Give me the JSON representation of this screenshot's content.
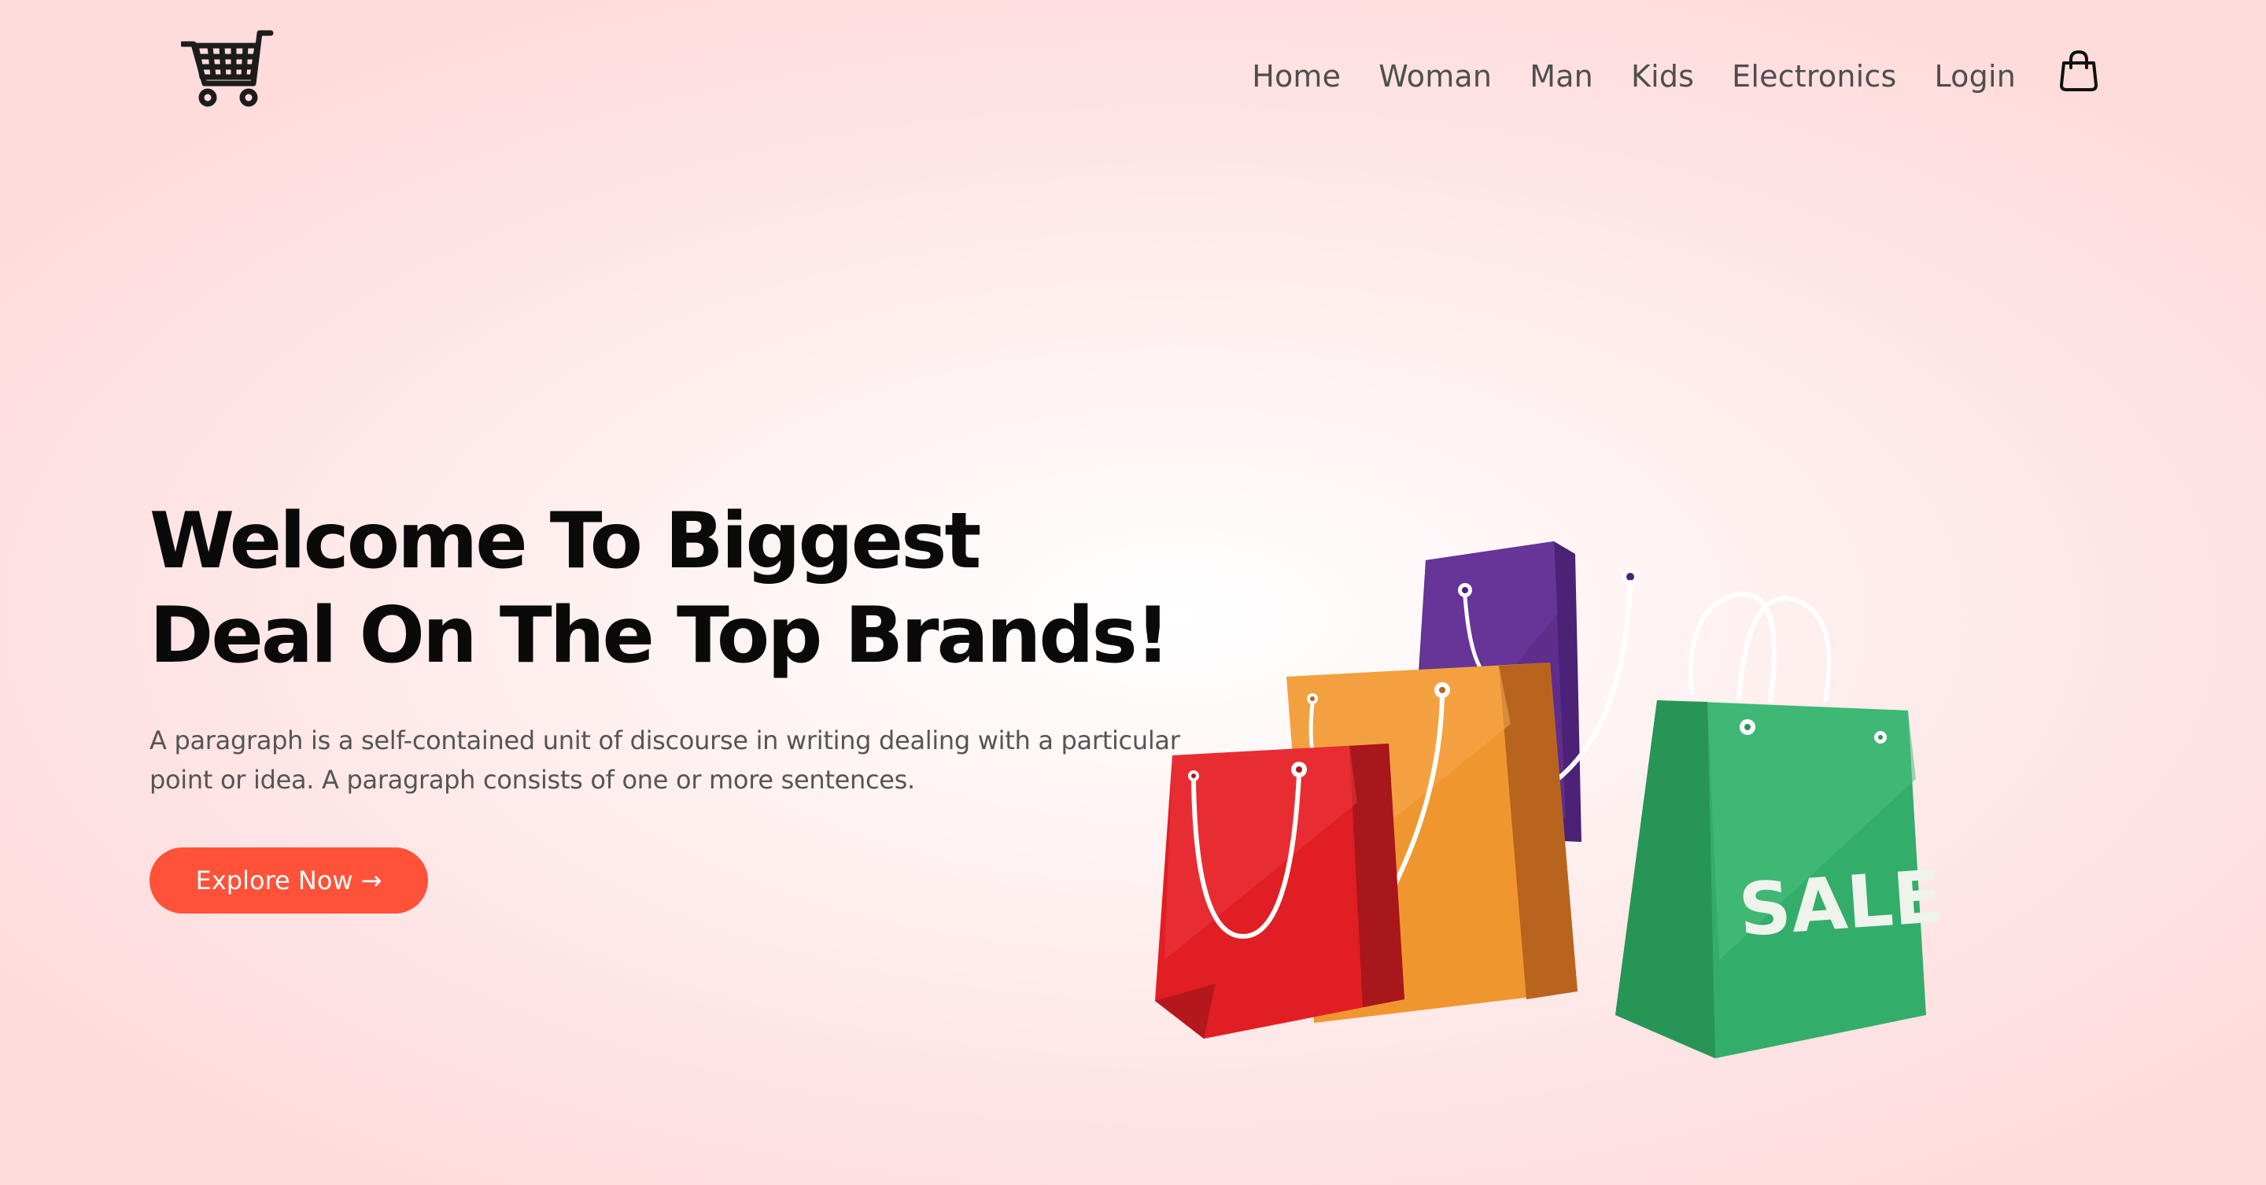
{
  "header": {
    "logo_icon": "shopping-cart-icon",
    "nav": [
      {
        "label": "Home"
      },
      {
        "label": "Woman"
      },
      {
        "label": "Man"
      },
      {
        "label": "Kids"
      },
      {
        "label": "Electronics"
      },
      {
        "label": "Login"
      }
    ],
    "bag_icon": "shopping-bag-icon"
  },
  "hero": {
    "title_line1": "Welcome To Biggest",
    "title_line2": "Deal On The Top Brands!",
    "paragraph": "A paragraph is a self-contained unit of discourse in writing dealing with a particular point or idea. A paragraph consists of one or more sentences.",
    "cta_label": "Explore Now",
    "cta_arrow": "→"
  },
  "illustration": {
    "sale_label": "SALE"
  },
  "colors": {
    "accent": "#ff5238",
    "heading": "#0a0a0a",
    "nav_text": "#4e4e4e",
    "bag_purple": "#5f2d8c",
    "bag_orange": "#f0962f",
    "bag_red": "#e01e24",
    "bag_green": "#33ad6a"
  }
}
